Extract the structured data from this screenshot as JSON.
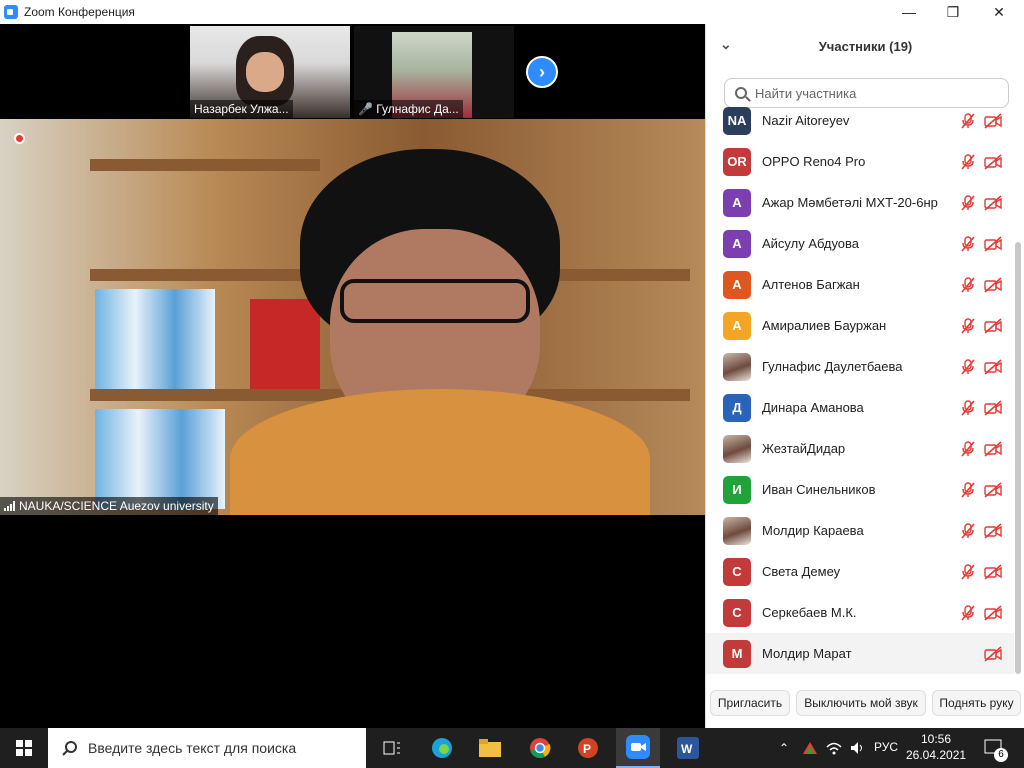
{
  "window": {
    "title": "Zoom Конференция"
  },
  "thumbnails": [
    {
      "name": "Назарбек Улжа..."
    },
    {
      "name": "Гулнафис Да..."
    }
  ],
  "main_video": {
    "name": "NAUKA/SCIENCE Auezov university"
  },
  "panel": {
    "title": "Участники (19)",
    "search_placeholder": "Найти участника",
    "participants": [
      {
        "initials": "NA",
        "name": "Nazir Aitoreyev",
        "color": "#2b3f5c",
        "mic_muted": true
      },
      {
        "initials": "OR",
        "name": "OPPO Reno4 Pro",
        "color": "#c23a3a",
        "mic_muted": true
      },
      {
        "initials": "А",
        "name": "Ажар Мәмбетәлі МХТ-20-6нр",
        "color": "#7b3fb0",
        "mic_muted": true
      },
      {
        "initials": "А",
        "name": "Айсулу Абдуова",
        "color": "#7b3fb0",
        "mic_muted": true
      },
      {
        "initials": "А",
        "name": "Алтенов Багжан",
        "color": "#e0561f",
        "mic_muted": true
      },
      {
        "initials": "А",
        "name": "Амиралиев Бауржан",
        "color": "#f5a524",
        "mic_muted": true
      },
      {
        "initials": "",
        "name": "Гулнафис Даулетбаева",
        "color": "photo",
        "mic_muted": true
      },
      {
        "initials": "Д",
        "name": "Динара Аманова",
        "color": "#2a64b8",
        "mic_muted": true
      },
      {
        "initials": "",
        "name": "ЖезтайДидар",
        "color": "photo",
        "mic_muted": true
      },
      {
        "initials": "И",
        "name": "Иван Синельников",
        "color": "#22a33a",
        "mic_muted": true
      },
      {
        "initials": "",
        "name": "Молдир Караева",
        "color": "photo",
        "mic_muted": true
      },
      {
        "initials": "С",
        "name": "Света Демеу",
        "color": "#c23a3a",
        "mic_muted": true
      },
      {
        "initials": "С",
        "name": "Серкебаев М.К.",
        "color": "#c23a3a",
        "mic_muted": true
      },
      {
        "initials": "М",
        "name": "Молдир Марат",
        "color": "#c23a3a",
        "mic_muted": false
      }
    ],
    "buttons": {
      "invite": "Пригласить",
      "mute_me": "Выключить мой звук",
      "raise_hand": "Поднять руку"
    }
  },
  "taskbar": {
    "search_placeholder": "Введите здесь текст для поиска",
    "language": "РУС",
    "time": "10:56",
    "date": "26.04.2021",
    "notifications": "6"
  },
  "colors": {
    "accent": "#2d8cff",
    "muted_red": "#e53935"
  }
}
